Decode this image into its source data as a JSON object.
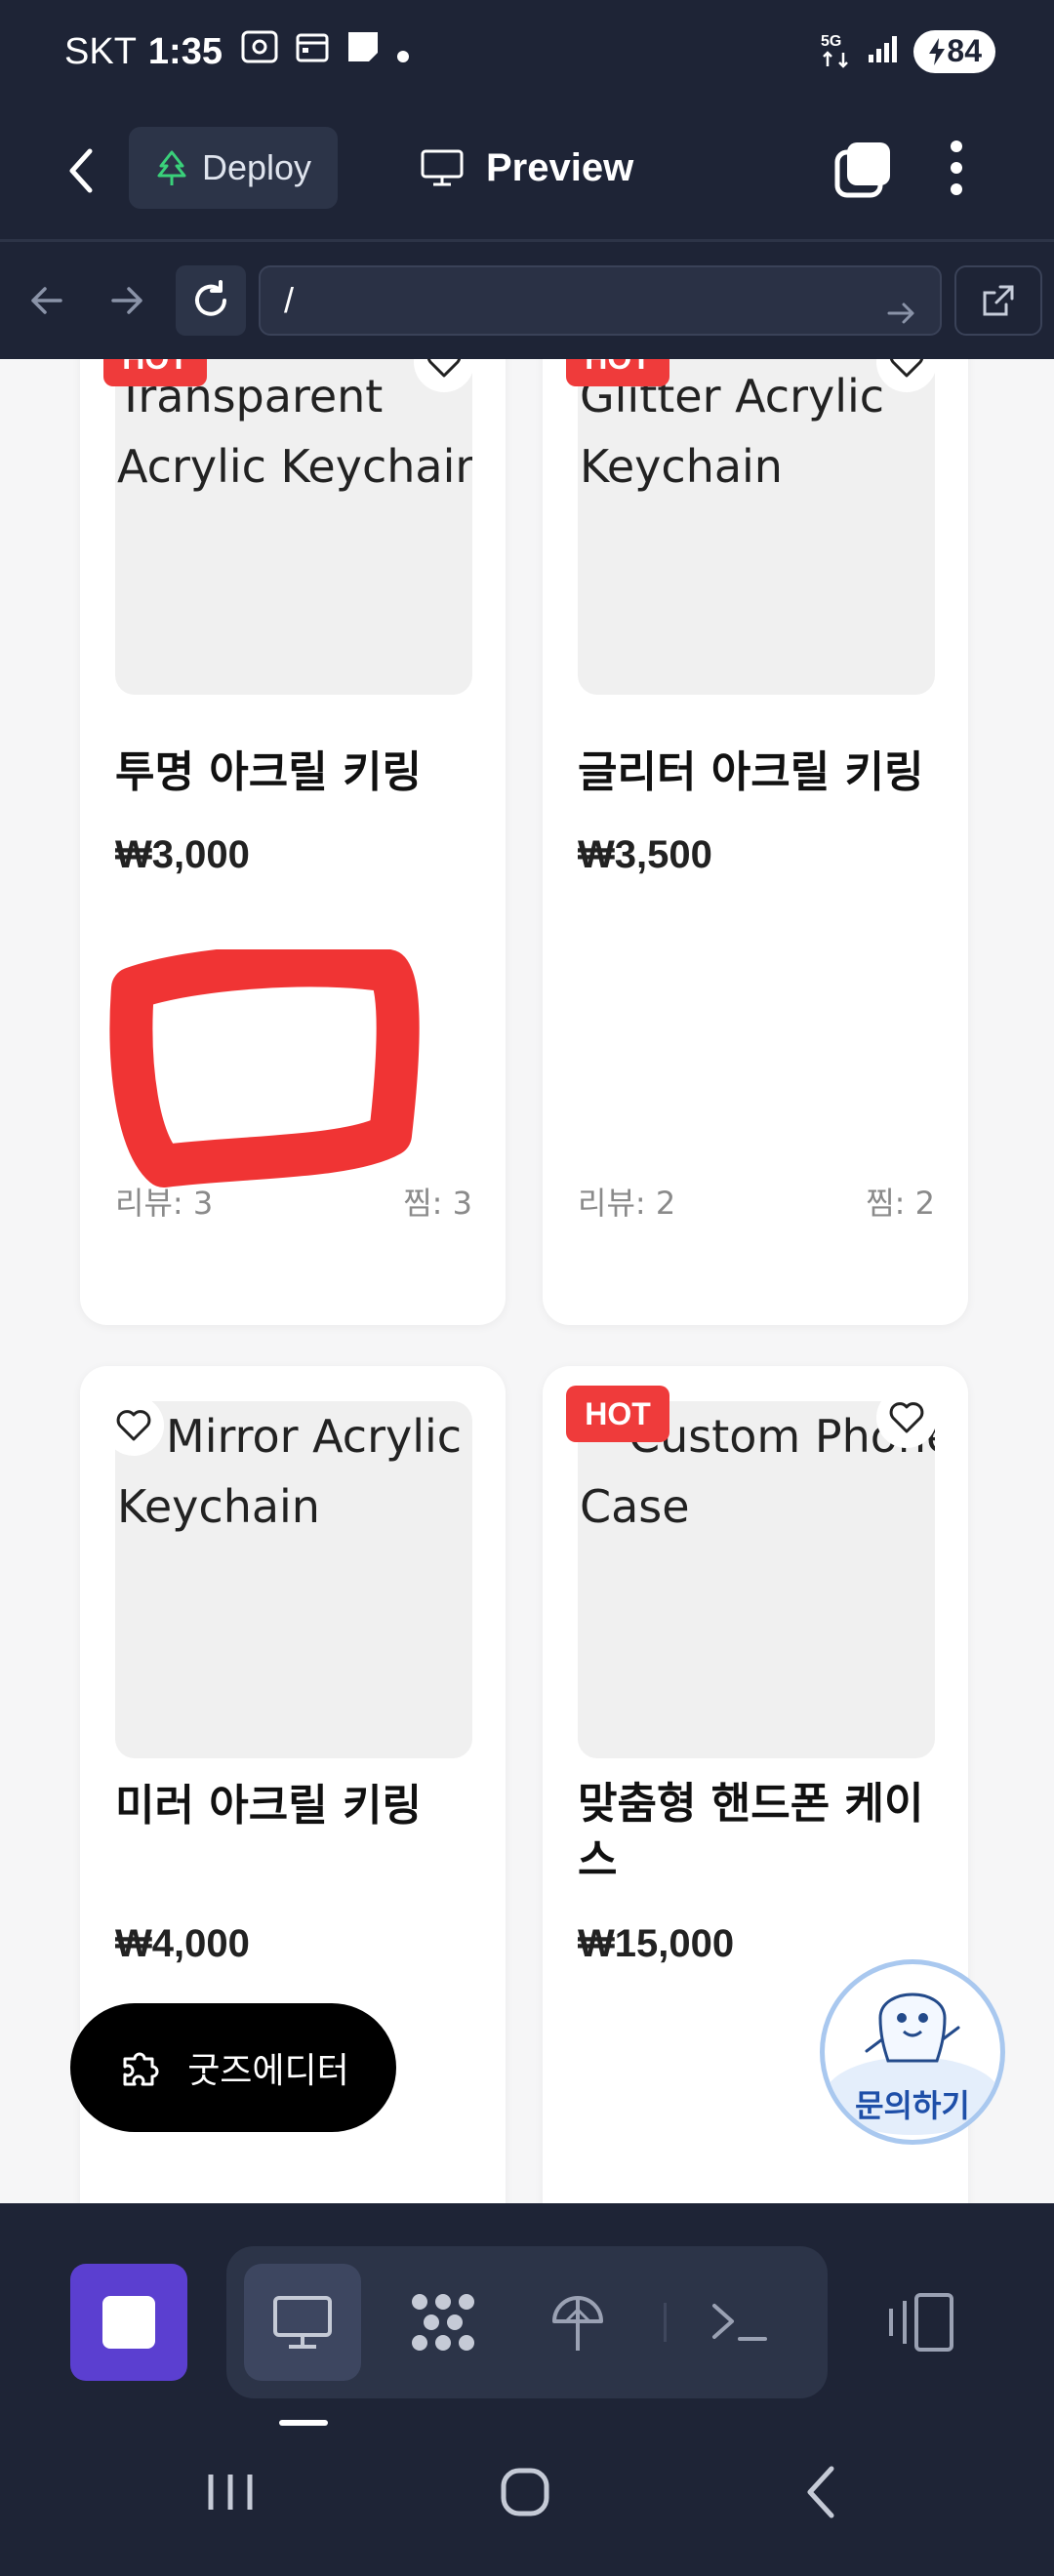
{
  "status_bar": {
    "carrier": "SKT",
    "time": "1:35",
    "network": "5G",
    "battery": "84"
  },
  "top_bar": {
    "deploy_label": "Deploy",
    "preview_label": "Preview"
  },
  "url_bar": {
    "url": "/"
  },
  "products": [
    {
      "image_alt": "Transparent Acrylic Keychain",
      "badge": "HOT",
      "title": "투명 아크릴 키링",
      "price": "₩3,000",
      "reviews": "리뷰: 3",
      "likes": "찜: 3"
    },
    {
      "image_alt": "Glitter Acrylic Keychain",
      "badge": "HOT",
      "title": "글리터 아크릴 키링",
      "price": "₩3,500",
      "reviews": "리뷰: 2",
      "likes": "찜: 2"
    },
    {
      "image_alt": "Mirror Acrylic Keychain",
      "badge": "",
      "title": "미러 아크릴 키링",
      "price": "₩4,000"
    },
    {
      "image_alt": "Custom Phone Case",
      "badge": "HOT",
      "title": "맞춤형 핸드폰 케이스",
      "price": "₩15,000"
    }
  ],
  "floating": {
    "goods_editor_label": "굿즈에디터",
    "inquiry_label": "문의하기"
  },
  "colors": {
    "dark_bg": "#1e2436",
    "hot_badge": "#ef3b3b",
    "accent_purple": "#5b3fd0",
    "annotation_red": "#f03434"
  }
}
